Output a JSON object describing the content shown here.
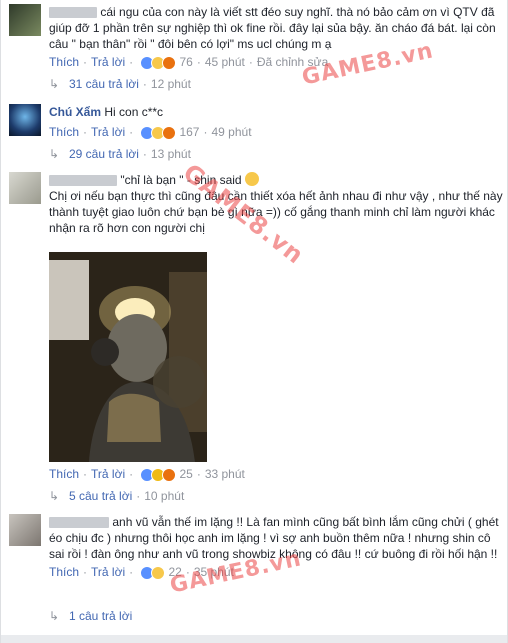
{
  "comments": [
    {
      "text": "cái ngu của con này là viết stt đéo suy nghĩ. thà nó bảo cảm ơn vì QTV đã giúp đỡ 1 phần trên sự nghiệp thì ok fine rồi. đây lại sủa bậy. ăn cháo đá bát. lại còn câu \" bạn thân\" rồi \" đôi bên có lợi\" ms ucl chúng m ạ",
      "like": "Thích",
      "reply": "Trả lời",
      "reaction_count": "76",
      "time": "45 phút",
      "edited": "Đã chỉnh sửa",
      "replies": "31 câu trả lời",
      "replies_time": "12 phút"
    },
    {
      "author": "Chú Xẩm",
      "text": "Hi con c**c",
      "like": "Thích",
      "reply": "Trả lời",
      "reaction_count": "167",
      "time": "49 phút",
      "replies": "29 câu trả lời",
      "replies_time": "13 phút"
    },
    {
      "quote": "\"chỉ là bạn \" - shin said",
      "text": "Chị ơi nếu bạn thực thì cũng đâu cần thiết xóa hết ảnh nhau đi như vậy , như thế này thành tuyệt giao luôn chứ bạn bè gì nữa =)) cố gắng thanh minh chỉ làm người khác nhận ra rõ hơn con người chị",
      "like": "Thích",
      "reply": "Trả lời",
      "reaction_count": "25",
      "time": "33 phút",
      "replies": "5 câu trả lời",
      "replies_time": "10 phút"
    },
    {
      "text": "anh vũ vẫn thế im lặng !! Là fan mình cũng bất bình lắm cũng chửi ( ghét éo chịu đc ) nhưng thôi học anh im lặng ! vì sợ anh buồn thêm nữa ! nhưng shin cô sai rồi ! đàn ông như anh vũ trong showbiz không có đâu !! cứ buông đi rồi hối hận !!",
      "like": "Thích",
      "reply": "Trả lời",
      "reaction_count": "22",
      "time": "35 phút",
      "replies": "1 câu trả lời"
    }
  ],
  "watermark": "GAME8.vn",
  "colors": {
    "link": "#4267b2",
    "author": "#365899",
    "meta": "#90949c",
    "watermark": "#eb4646"
  }
}
